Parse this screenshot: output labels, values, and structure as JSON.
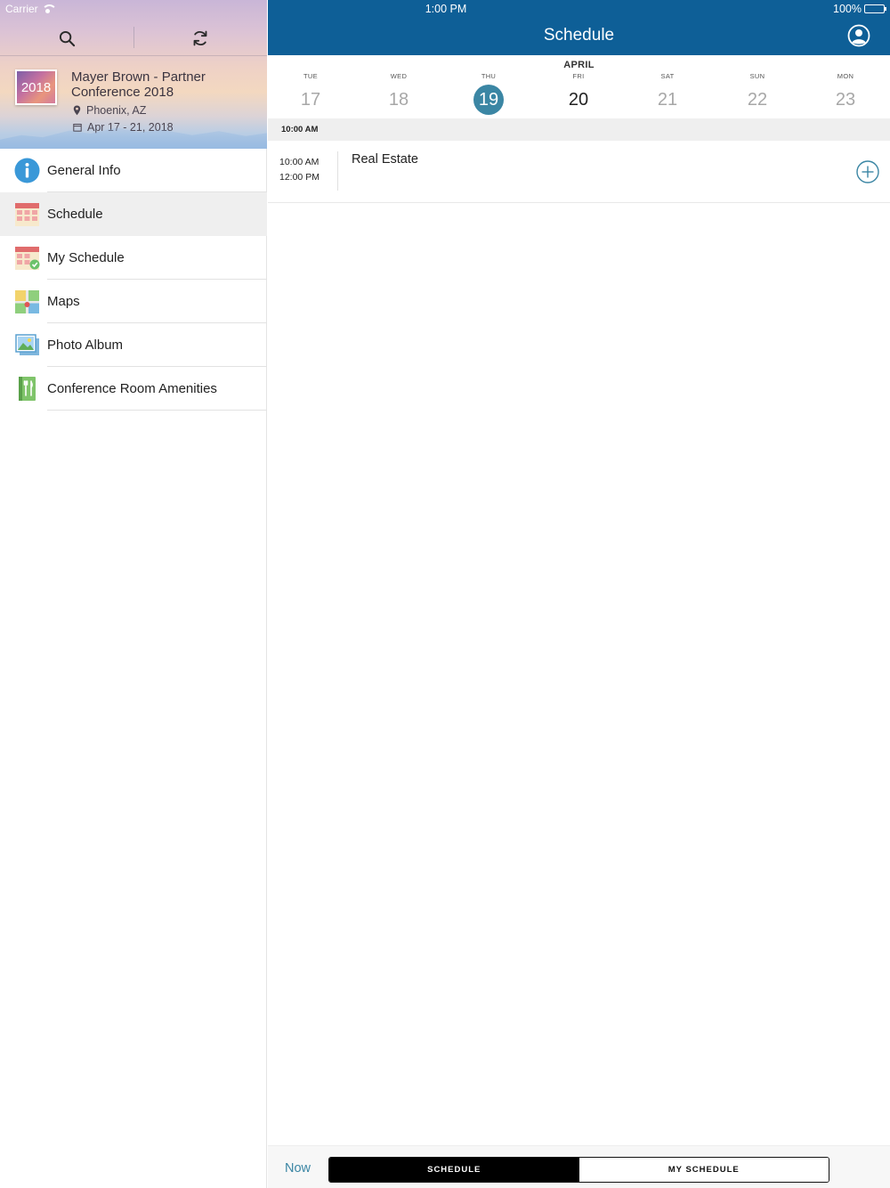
{
  "status_bar": {
    "carrier": "Carrier",
    "time": "1:00 PM",
    "battery": "100%"
  },
  "sidebar": {
    "event": {
      "logo_text": "2018",
      "title": "Mayer Brown - Partner Conference 2018",
      "location": "Phoenix, AZ",
      "dates": "Apr 17 - 21, 2018"
    },
    "items": [
      {
        "label": "General Info",
        "icon": "info-icon"
      },
      {
        "label": "Schedule",
        "icon": "calendar-icon",
        "active": true
      },
      {
        "label": "My Schedule",
        "icon": "calendar-check-icon"
      },
      {
        "label": "Maps",
        "icon": "map-icon"
      },
      {
        "label": "Photo Album",
        "icon": "photo-icon"
      },
      {
        "label": "Conference Room Amenities",
        "icon": "amenities-icon"
      }
    ]
  },
  "header": {
    "title": "Schedule",
    "color": "#0e5f97"
  },
  "date_strip": {
    "month": "APRIL",
    "days": [
      {
        "dow": "TUE",
        "day": "17"
      },
      {
        "dow": "WED",
        "day": "18"
      },
      {
        "dow": "THU",
        "day": "19",
        "selected": true
      },
      {
        "dow": "FRI",
        "day": "20",
        "current": true
      },
      {
        "dow": "SAT",
        "day": "21"
      },
      {
        "dow": "SUN",
        "day": "22"
      },
      {
        "dow": "MON",
        "day": "23"
      }
    ],
    "selected_color": "#3b86a4"
  },
  "schedule": {
    "time_header": "10:00 AM",
    "sessions": [
      {
        "start": "10:00 AM",
        "end": "12:00 PM",
        "title": "Real Estate"
      }
    ]
  },
  "bottom_bar": {
    "now_label": "Now",
    "segments": [
      "SCHEDULE",
      "MY SCHEDULE"
    ],
    "active_segment": "SCHEDULE"
  }
}
